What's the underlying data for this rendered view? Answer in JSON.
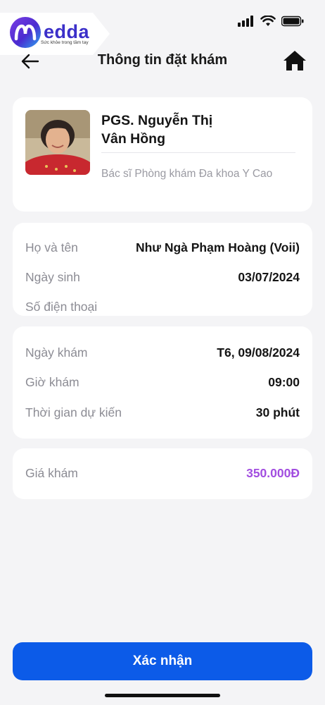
{
  "brand": {
    "logo_text": "edda",
    "tagline": "Sức khỏe trong tầm tay"
  },
  "header": {
    "title": "Thông tin đặt khám",
    "back_icon": "arrow-left-icon",
    "home_icon": "home-icon"
  },
  "doctor": {
    "name_line1": "PGS. Nguyễn Thị",
    "name_line2": "Vân Hồng",
    "clinic": "Bác sĩ Phòng khám Đa khoa Y Cao"
  },
  "patient": {
    "name_label": "Họ và tên",
    "name_value": "Như Ngà Phạm Hoàng (Voii)",
    "dob_label": "Ngày sinh",
    "dob_value": "03/07/2024",
    "phone_label": "Số điện thoại",
    "phone_value": ""
  },
  "appointment": {
    "date_label": "Ngày khám",
    "date_value": "T6, 09/08/2024",
    "time_label": "Giờ khám",
    "time_value": "09:00",
    "duration_label": "Thời gian dự kiến",
    "duration_value": "30 phút"
  },
  "price": {
    "label": "Giá khám",
    "value": "350.000Đ"
  },
  "actions": {
    "confirm_label": "Xác nhận"
  },
  "colors": {
    "primary": "#0c5be8",
    "price": "#a24ee0",
    "background": "#f4f4f6"
  }
}
